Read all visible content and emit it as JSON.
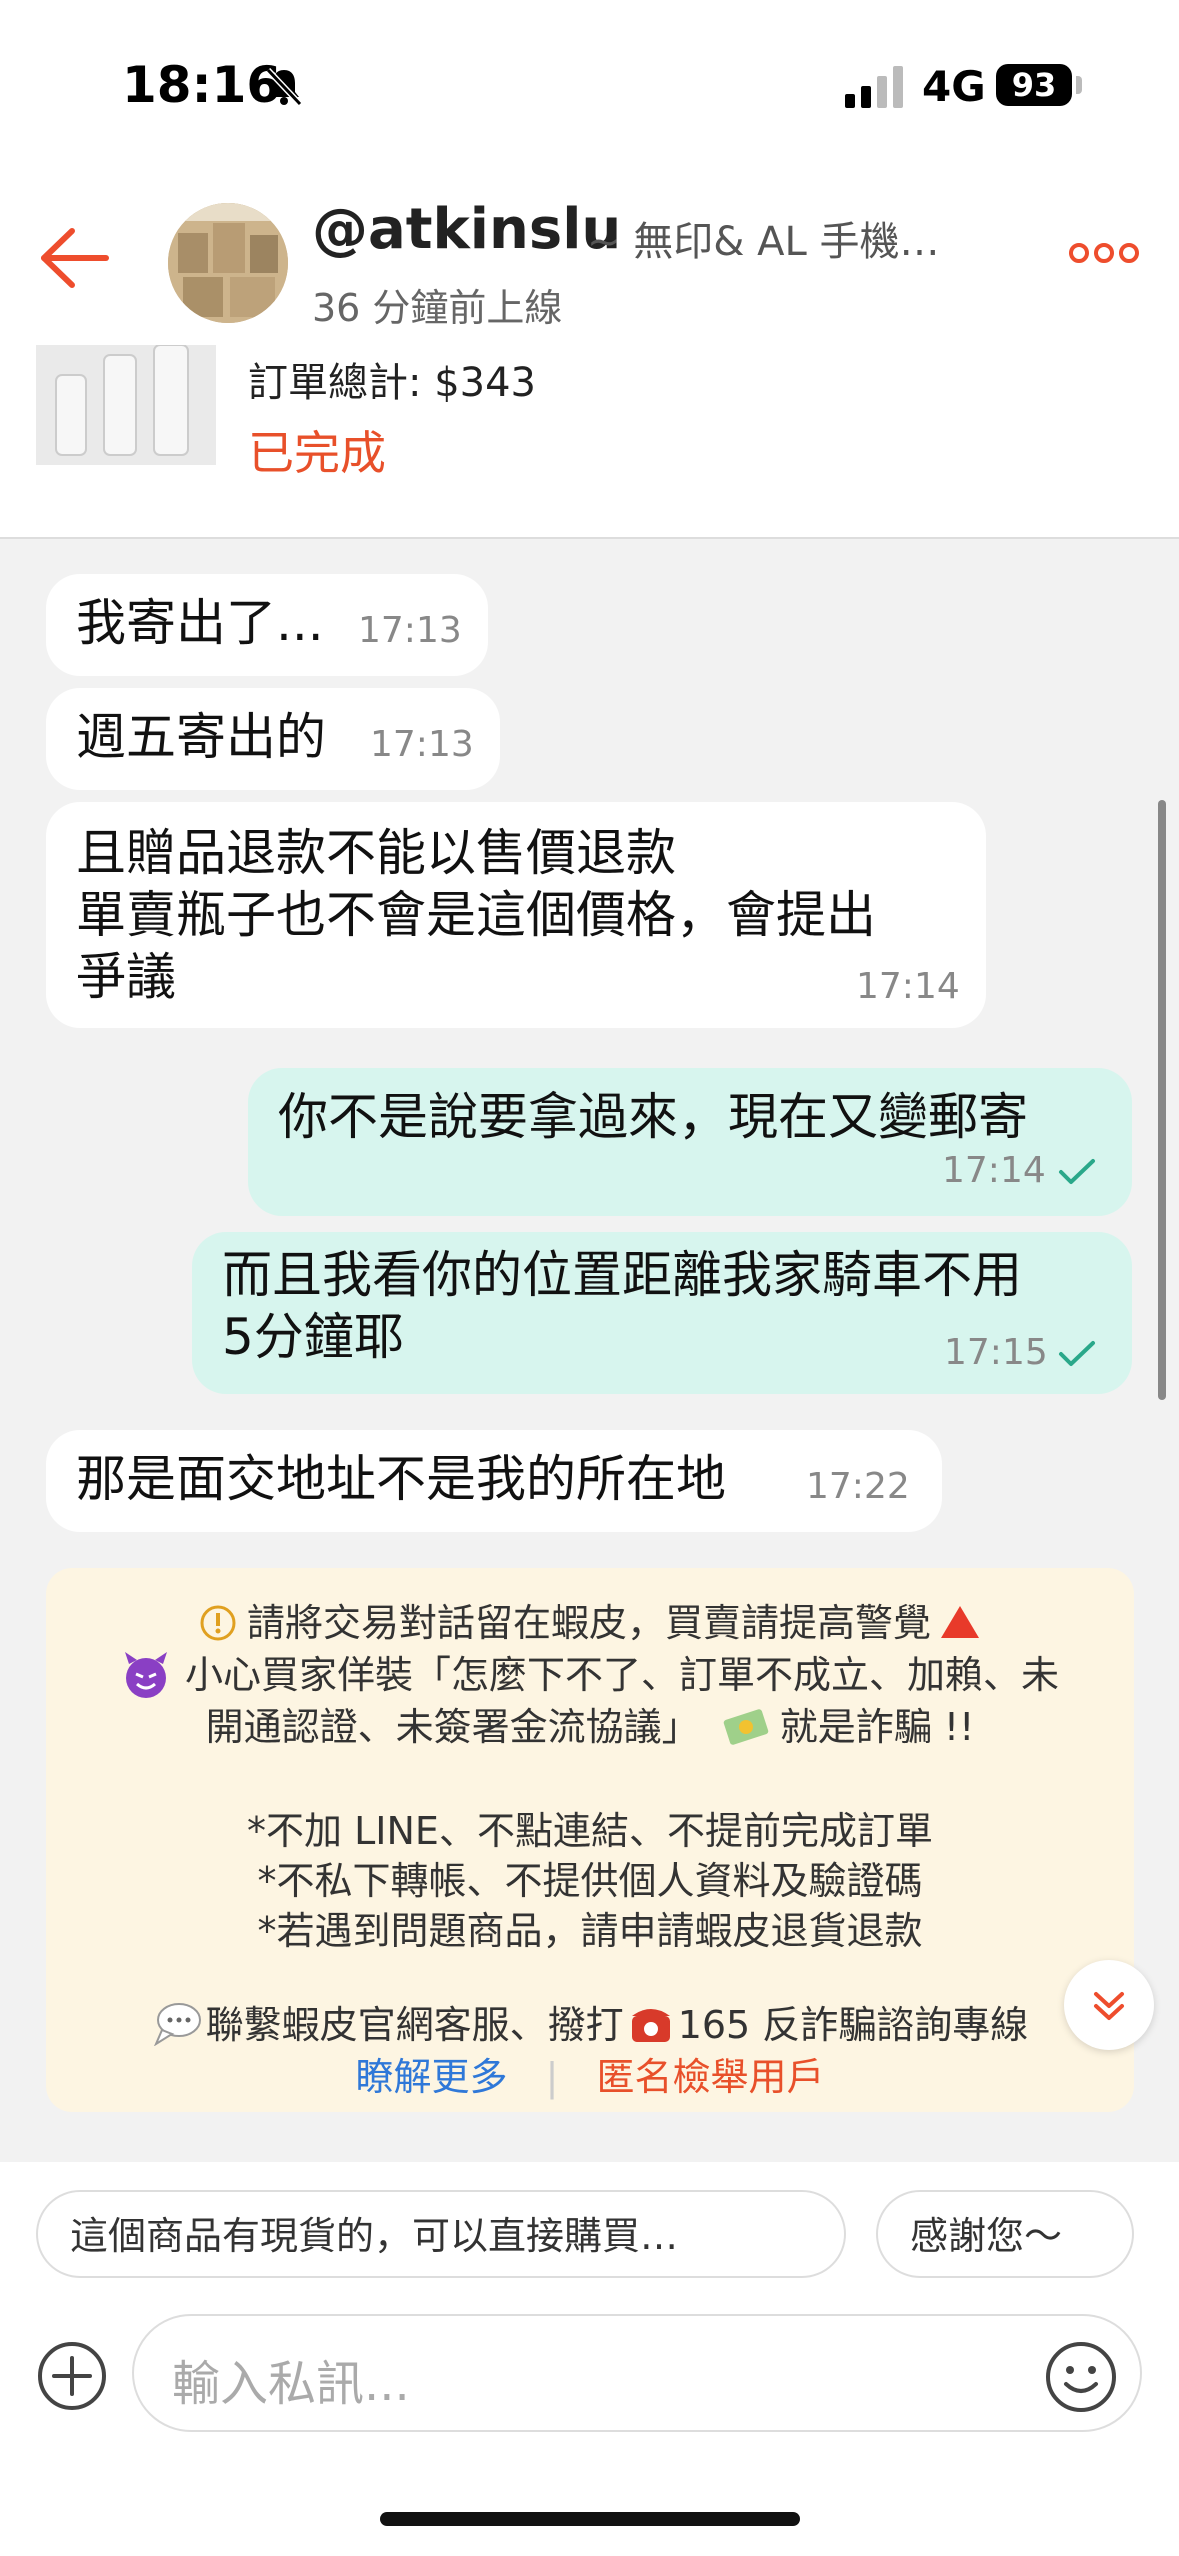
{
  "status": {
    "time": "18:16",
    "network": "4G",
    "battery": "93"
  },
  "header": {
    "username": "@atkinslu",
    "shop_name": "~ 無印& AL 手機…",
    "online_status": "36 分鐘前上線"
  },
  "order": {
    "total": "訂單總計: $343",
    "status": "已完成"
  },
  "messages": [
    {
      "direction": "in",
      "lines": [
        "我寄出了..."
      ],
      "time": "17:13"
    },
    {
      "direction": "in",
      "lines": [
        "週五寄出的"
      ],
      "time": "17:13"
    },
    {
      "direction": "in",
      "lines": [
        "且贈品退款不能以售價退款",
        "單賣瓶子也不會是這個價格，會提出",
        "爭議"
      ],
      "time": "17:14"
    },
    {
      "direction": "out",
      "lines": [
        "你不是說要拿過來，現在又變郵寄"
      ],
      "time": "17:14"
    },
    {
      "direction": "out",
      "lines": [
        "而且我看你的位置距離我家騎車不用",
        "5分鐘耶"
      ],
      "time": "17:15"
    },
    {
      "direction": "in",
      "lines": [
        "那是面交地址不是我的所在地"
      ],
      "time": "17:22"
    }
  ],
  "warning": {
    "line1": "請將交易對話留在蝦皮，買賣請提高警覺",
    "line2": "小心買家佯裝「怎麼下不了、訂單不成立、加賴、未",
    "line3": "開通認證、未簽署金流協議」",
    "line3_end": "就是詐騙 !!",
    "rule1": "*不加 LINE、不點連結、不提前完成訂單",
    "rule2": "*不私下轉帳、不提供個人資料及驗證碼",
    "rule3": "*若遇到問題商品，請申請蝦皮退貨退款",
    "contact_a": "聯繫蝦皮官網客服、撥打",
    "contact_b": "165 反詐騙諮詢專線",
    "learn_more": "瞭解更多",
    "report": "匿名檢舉用戶"
  },
  "quick_replies": [
    "這個商品有現貨的，可以直接購買…",
    "感謝您～"
  ],
  "composer": {
    "placeholder": "輸入私訊..."
  },
  "colors": {
    "accent": "#ee4d2d",
    "outgoing_bubble": "#d7f5ee",
    "warning_bg": "#fdf5e2",
    "link": "#2f78d8"
  },
  "icons": [
    "bell-slash-icon",
    "signal-icon",
    "back-arrow-icon",
    "more-icon",
    "check-icon",
    "warning-circle-icon",
    "devil-emoji-icon",
    "money-emoji-icon",
    "speech-bubble-icon",
    "telephone-icon",
    "chevron-down-icon",
    "plus-icon",
    "smiley-icon"
  ]
}
